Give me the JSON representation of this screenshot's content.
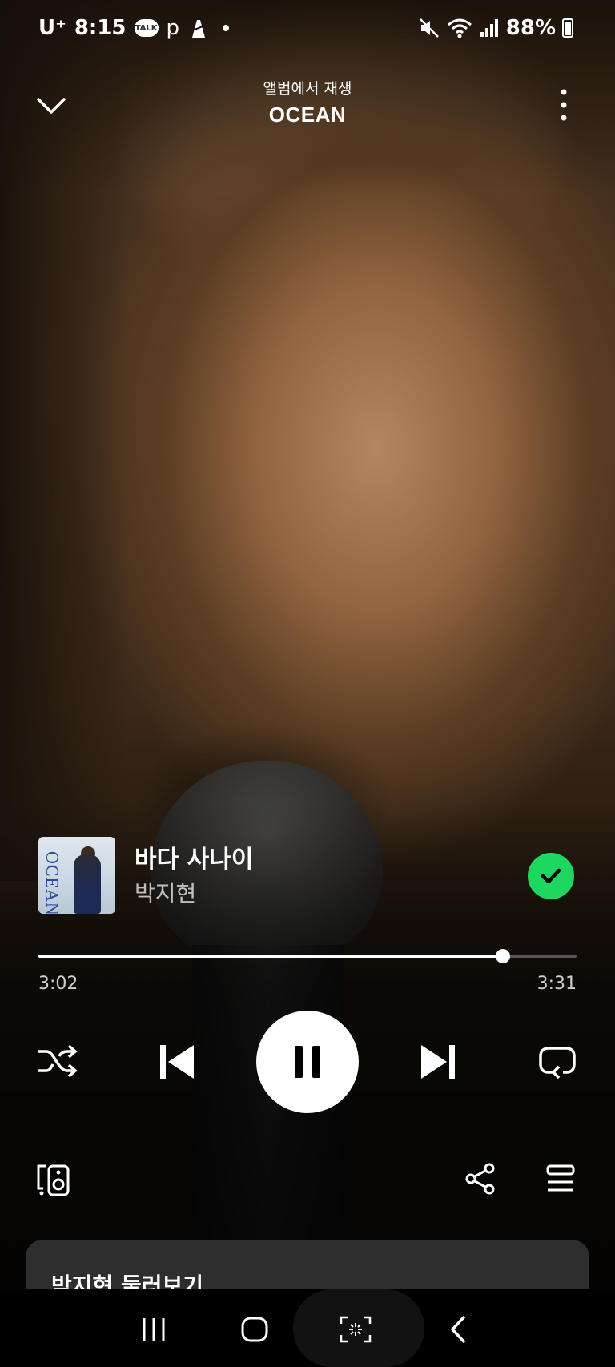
{
  "status_bar": {
    "carrier": "U⁺",
    "time": "8:15",
    "talk_badge": "TALK",
    "p_label": "p",
    "battery": "88%"
  },
  "header": {
    "subtitle": "앨범에서 재생",
    "title": "OCEAN"
  },
  "album_art": {
    "text": "OCEAN"
  },
  "track": {
    "title": "바다 사나이",
    "artist": "박지현",
    "liked": true
  },
  "progress": {
    "elapsed": "3:02",
    "total": "3:31",
    "fraction": 0.8626
  },
  "sheet": {
    "title": "박지현 둘러보기"
  },
  "colors": {
    "accent": "#1ed760",
    "background": "#000000",
    "sheet": "#2e2e2e"
  },
  "icons": {
    "down": "chevron-down-icon",
    "more": "more-vertical-icon",
    "shuffle": "shuffle-icon",
    "previous": "skip-previous-icon",
    "pause": "pause-icon",
    "next": "skip-next-icon",
    "repeat": "repeat-icon",
    "devices": "connect-device-icon",
    "share": "share-icon",
    "queue": "queue-icon"
  }
}
